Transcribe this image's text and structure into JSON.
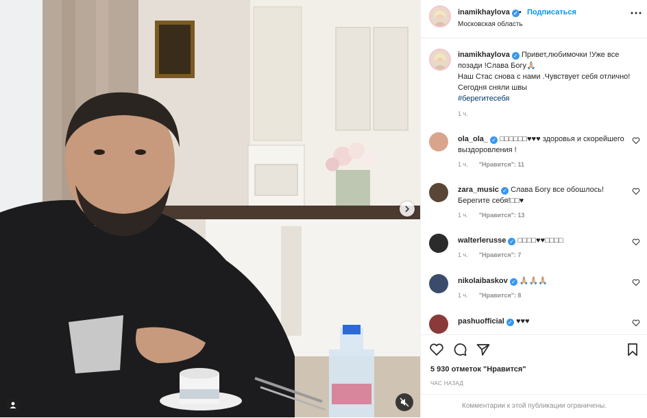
{
  "post": {
    "author": "inamikhaylova",
    "follow_label": "Подписаться",
    "location": "Московская область",
    "caption_line1": "Привет,любимочки !Уже все позади !Слава Богу🙏🏼",
    "caption_line2": "Наш Стас снова с нами .Чувствует себя отлично! Сегодня сняли швы",
    "hashtag": "#берегитесебя",
    "caption_time": "1 ч."
  },
  "comments": [
    {
      "user": "ola_ola_",
      "verified": true,
      "text": "□□□□□□♥♥♥ здоровья и скорейшего выздоровления !",
      "time": "1 ч.",
      "likes": "\"Нравится\": 11",
      "avatar_color": "#d9a48c"
    },
    {
      "user": "zara_music",
      "verified": true,
      "text": "Слава Богу все обошлось! Берегите себя!□□♥",
      "time": "1 ч.",
      "likes": "\"Нравится\": 13",
      "avatar_color": "#5a4636"
    },
    {
      "user": "walterlerusse",
      "verified": true,
      "text": "□□□□♥♥□□□□",
      "time": "1 ч.",
      "likes": "\"Нравится\": 7",
      "avatar_color": "#2b2b2b"
    },
    {
      "user": "nikolaibaskov",
      "verified": true,
      "text": "🙏🏼🙏🏼🙏🏼",
      "time": "1 ч.",
      "likes": "\"Нравится\": 8",
      "avatar_color": "#3b4b6b"
    },
    {
      "user": "pashuofficial",
      "verified": true,
      "text": "♥♥♥",
      "time": "",
      "likes": "",
      "avatar_color": "#8a3a3a"
    }
  ],
  "actions": {
    "likes_count": "5 930 отметок \"Нравится\"",
    "time_ago": "ЧАС НАЗАД",
    "comments_closed": "Комментарии к этой публикации ограничены."
  },
  "icons": [
    "heart-icon",
    "comment-icon",
    "share-icon",
    "bookmark-icon",
    "more-icon",
    "chevron-right-icon",
    "mute-icon",
    "tag-user-icon",
    "verified-icon"
  ],
  "colors": {
    "accent": "#0095f6",
    "verified": "#3897f0",
    "muted": "#8e8e8e",
    "heart_red": "#c00000"
  }
}
